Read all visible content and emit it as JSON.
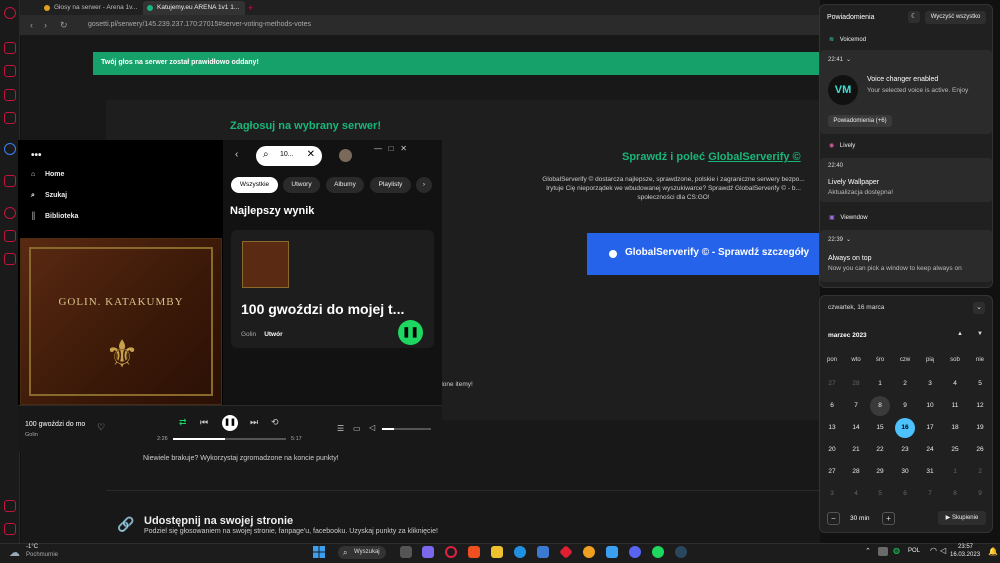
{
  "browser": {
    "tabs": [
      {
        "label": "Głosy na serwer - Arena 1v..."
      },
      {
        "label": "Katujemy.eu ARENA 1v1 1..."
      }
    ],
    "url": "gosetti.pl/serwery/145.239.237.170:27015#server-voting-methods-votes"
  },
  "page": {
    "alert": "Twój głos na serwer został prawidłowo oddany!",
    "vote_title": "Zagłosuj na wybrany serwer!",
    "check_title_prefix": "Sprawdź i poleć ",
    "check_title_link": "GlobalServerify ©",
    "gs_desc_1": "GlobalServerify © dostarcza najlepsze, sprawdzone, polskie i zagraniczne serwery bezpo...",
    "gs_desc_2": "Irytuje Cię nieporządek we wbudowanej wyszukiwarce? Sprawdź GlobalServerify © - b...",
    "gs_desc_3": "społeczności dla CS:GO!",
    "gs_button": "GlobalServerify © - Sprawdź szczegóły",
    "items_text": "stawione itemy!",
    "missing_text": "Niewiele brakuje? Wykorzystaj zgromadzone na koncie punkty!",
    "share_title": "Udostępnij na swojej stronie",
    "share_desc": "Podziel się głosowaniem na swojej stronie, fanpage'u, facebooku. Uzyskaj punkty za kliknięcie!"
  },
  "spotify": {
    "nav": [
      {
        "label": "Home",
        "icon": "home-icon"
      },
      {
        "label": "Szukaj",
        "icon": "search-icon"
      },
      {
        "label": "Biblioteka",
        "icon": "library-icon"
      }
    ],
    "search_value": "10...",
    "chips": [
      "Wszystkie",
      "Utwory",
      "Albumy",
      "Playlisty"
    ],
    "best_heading": "Najlepszy wynik",
    "best_track": "100 gwoździ do mojej t...",
    "best_artist": "Golin",
    "best_type": "Utwór",
    "cover_title": "GOLIN. KATAKUMBY",
    "now_playing_title": "100 gwoździ do mo",
    "now_playing_artist": "Golin",
    "elapsed": "2:26",
    "total": "5:17",
    "progress": 0.46,
    "volume": 0.25
  },
  "notifications": {
    "title": "Powiadomienia",
    "clear_all": "Wyczyść wszystko",
    "groups": [
      {
        "app": "Voicemod",
        "time": "22:41",
        "head": "Voice changer enabled",
        "body": "Your selected voice is active. Enjoy",
        "more": "Powiadomienia (+6)"
      },
      {
        "app": "Lively",
        "time": "22:40",
        "head": "Lively Wallpaper",
        "body": "Aktualizacja dostępna!"
      },
      {
        "app": "Viewndow",
        "time": "22:39",
        "head": "Always on top",
        "body": "Now you can pick a window to keep always on"
      }
    ]
  },
  "calendar": {
    "date_header": "czwartek, 16 marca",
    "month": "marzec 2023",
    "dow": [
      "pon",
      "wto",
      "śro",
      "czw",
      "pią",
      "sob",
      "nie"
    ],
    "weeks": [
      [
        "27",
        "28",
        "1",
        "2",
        "3",
        "4",
        "5"
      ],
      [
        "6",
        "7",
        "8",
        "9",
        "10",
        "11",
        "12"
      ],
      [
        "13",
        "14",
        "15",
        "16",
        "17",
        "18",
        "19"
      ],
      [
        "20",
        "21",
        "22",
        "23",
        "24",
        "25",
        "26"
      ],
      [
        "27",
        "28",
        "29",
        "30",
        "31",
        "1",
        "2"
      ],
      [
        "3",
        "4",
        "5",
        "6",
        "7",
        "8",
        "9"
      ]
    ],
    "today": "16",
    "focus_minutes": "30 min",
    "focus_button": "Skupienie"
  },
  "taskbar": {
    "temp": "-1°C",
    "weather": "Pochmurnie",
    "search": "Wyszukaj",
    "lang": "POL",
    "time": "23:57",
    "date": "16.03.2023"
  },
  "colors": {
    "accent_green": "#19b67a",
    "spotify_green": "#1ed760",
    "today_blue": "#4cc2ff",
    "button_blue": "#2563eb"
  }
}
